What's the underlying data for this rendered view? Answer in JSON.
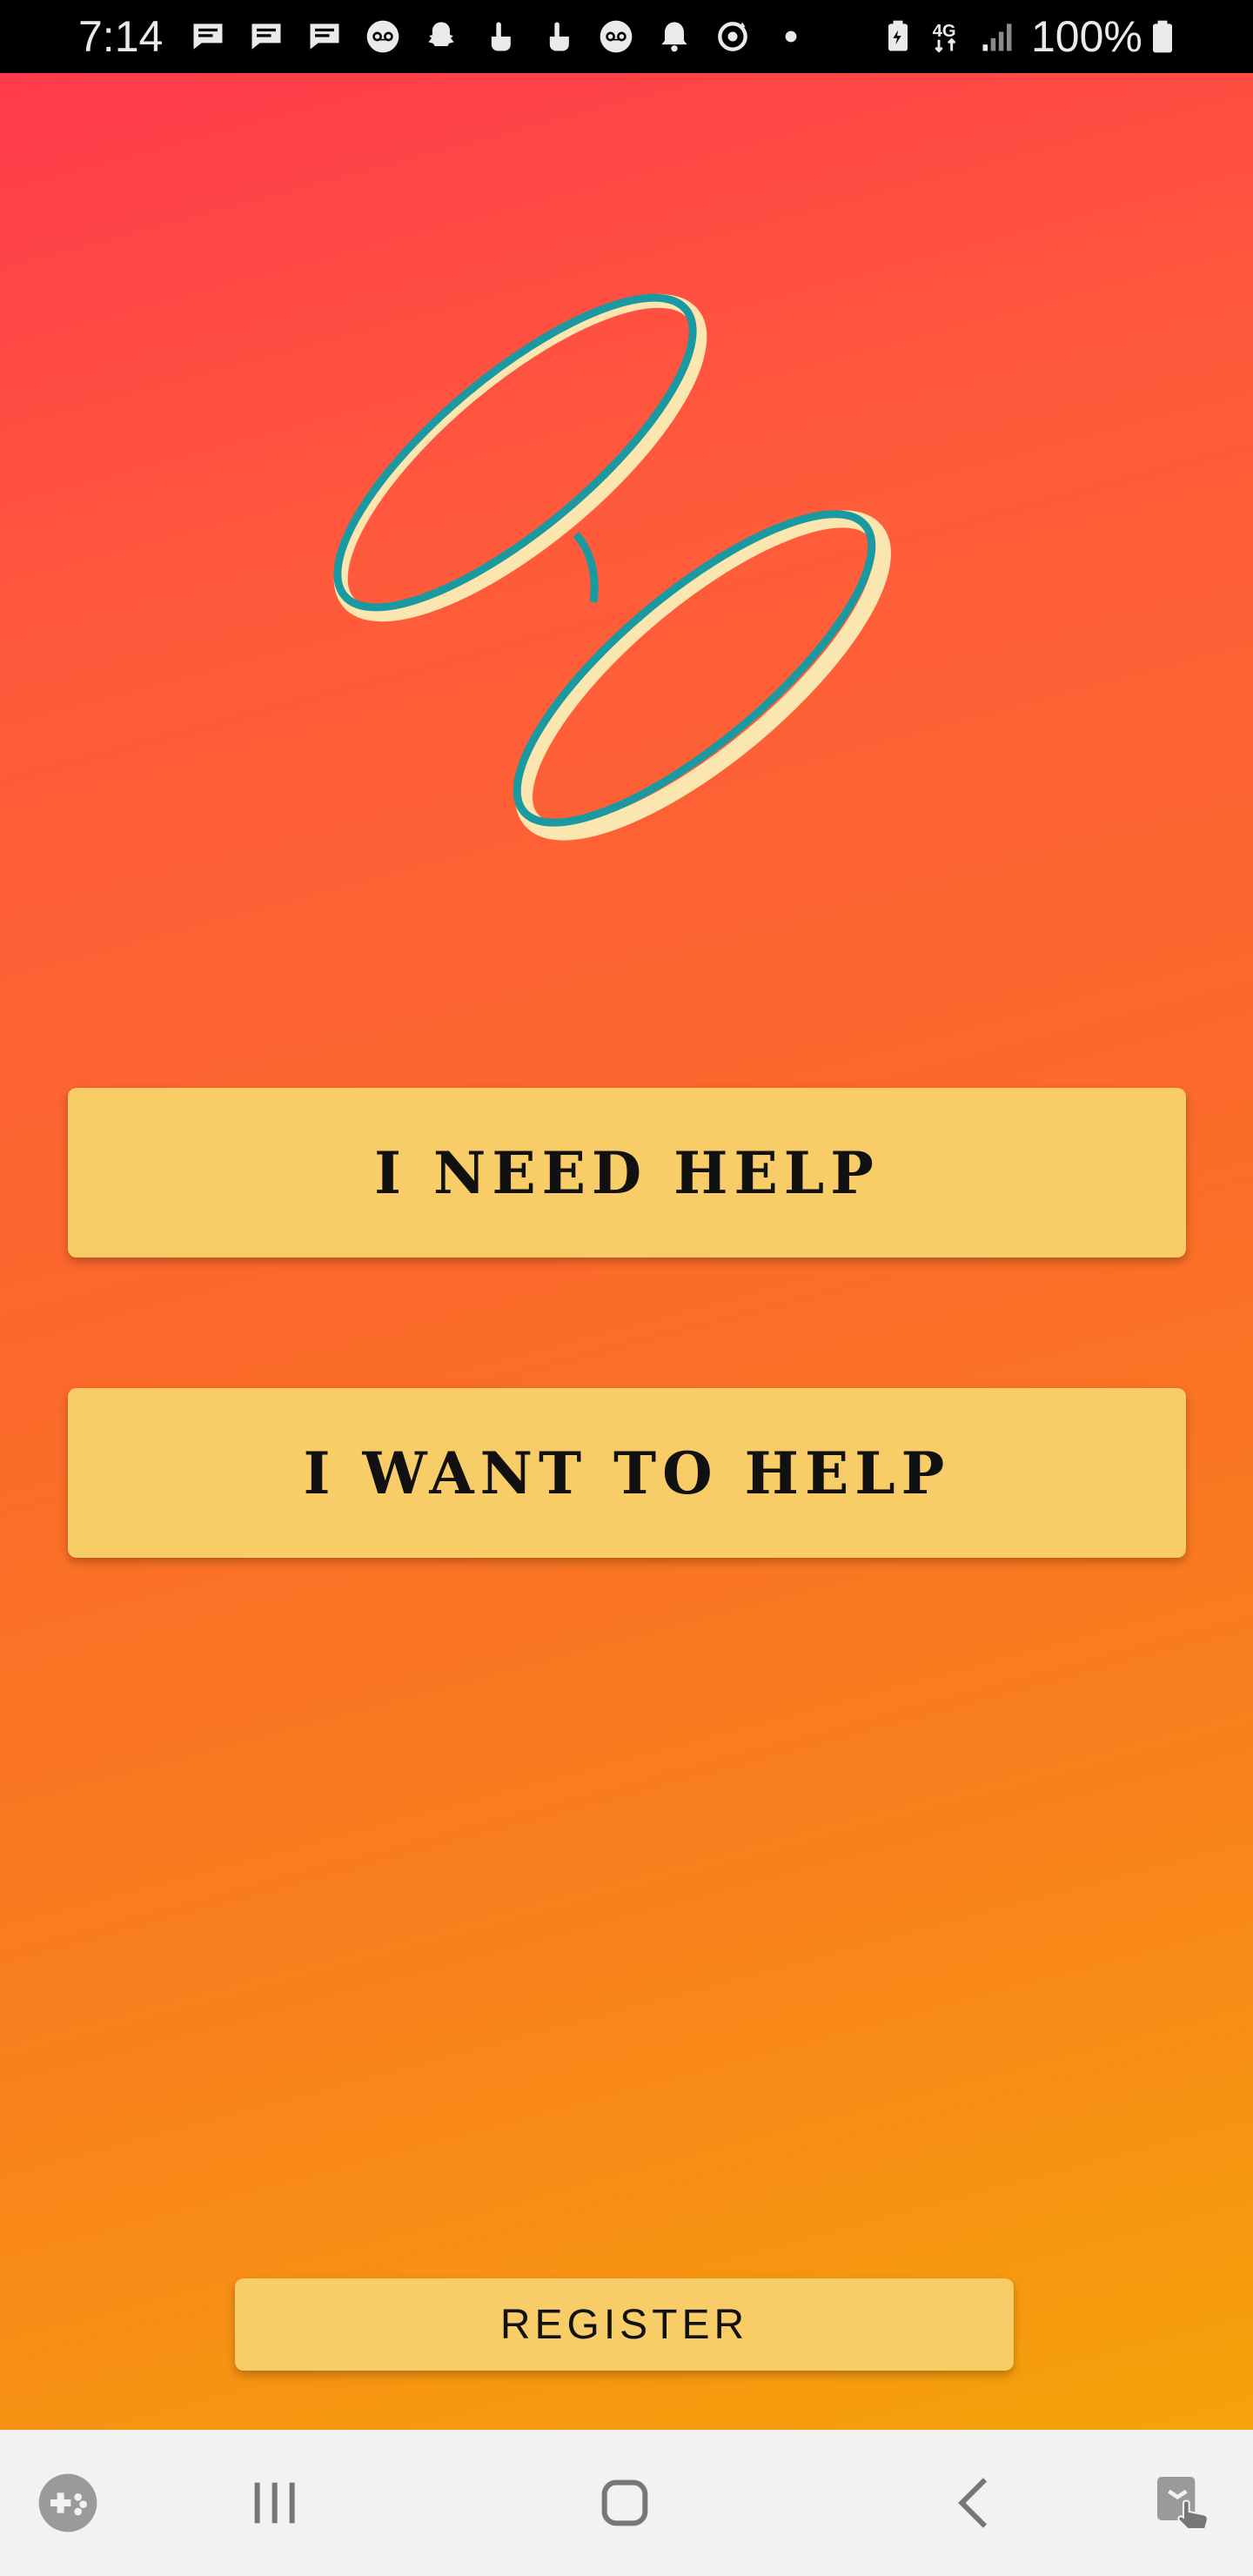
{
  "status_bar": {
    "time": "7:14",
    "battery_percent": "100%",
    "network": "4G",
    "left_icons": [
      "message-icon",
      "message-icon",
      "message-icon",
      "voicemail-icon",
      "snapchat-icon",
      "touch-icon",
      "touch-icon",
      "voicemail-icon",
      "bell-icon",
      "sync-icon",
      "dot-icon"
    ],
    "right_icons": [
      "battery-saver-icon",
      "4g-icon",
      "signal-icon",
      "battery-icon"
    ]
  },
  "app": {
    "background_colors": [
      "#ff3a4c",
      "#fb6a2a",
      "#f6a30a"
    ],
    "logo": {
      "name": "interlocking-rings-logo",
      "ring_color": "#1a9aa0",
      "shadow_color": "#fbe6b0"
    },
    "buttons": {
      "need_help": "I NEED HELP",
      "want_help": "I WANT TO HELP",
      "register": "REGISTER"
    },
    "button_color": "#f8cc67"
  },
  "nav_bar": {
    "items": [
      "game-launcher-icon",
      "recent-apps-icon",
      "home-icon",
      "back-icon",
      "screen-pin-icon"
    ]
  }
}
